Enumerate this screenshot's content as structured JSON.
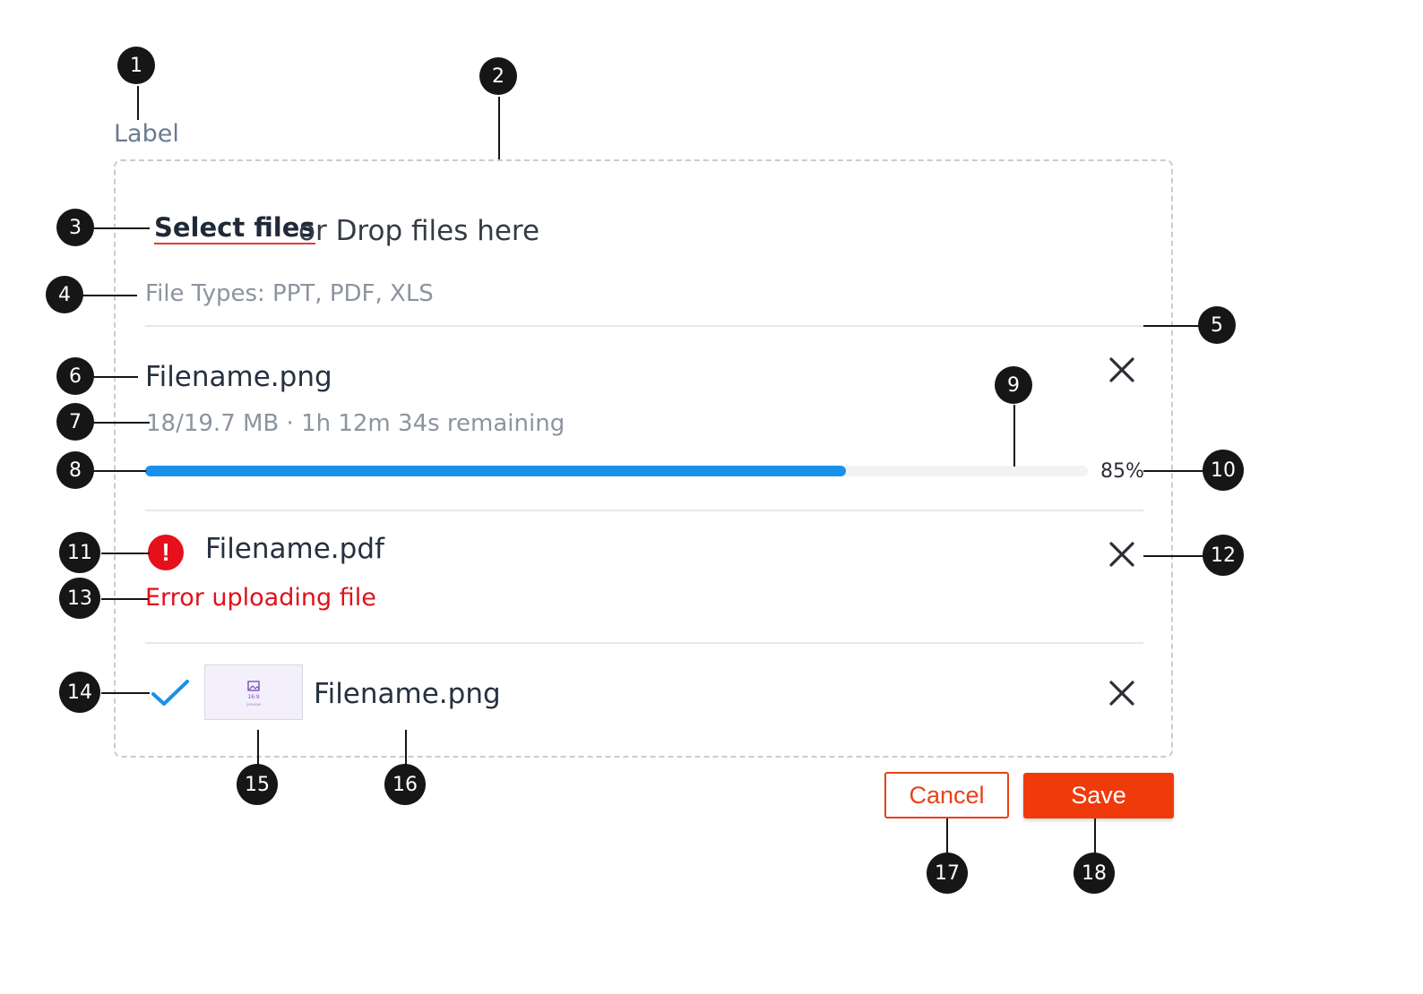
{
  "uploader": {
    "label": "Label",
    "select_files": "Select files",
    "drop_text": "or Drop files here",
    "file_types": "File Types: PPT, PDF, XLS"
  },
  "files": [
    {
      "name": "Filename.png",
      "status": "uploading",
      "meta": "18/19.7 MB · 1h 12m 34s remaining",
      "progress_percent": 85,
      "progress_label": "85%",
      "remove_icon": "close-icon"
    },
    {
      "name": "Filename.pdf",
      "status": "error",
      "status_icon": "error-icon",
      "status_icon_glyph": "!",
      "error_message": "Error uploading file",
      "remove_icon": "close-icon"
    },
    {
      "name": "Filename.png",
      "status": "complete",
      "status_icon": "check-icon",
      "thumbnail": {
        "line1": "16:9",
        "line2": "preview"
      },
      "remove_icon": "close-icon"
    }
  ],
  "actions": {
    "cancel": "Cancel",
    "save": "Save"
  },
  "callouts": [
    "1",
    "2",
    "3",
    "4",
    "5",
    "6",
    "7",
    "8",
    "9",
    "10",
    "11",
    "12",
    "13",
    "14",
    "15",
    "16",
    "17",
    "18"
  ],
  "colors": {
    "accent": "#f03a0c",
    "progress": "#1991eb",
    "error": "#e5101a",
    "success_check": "#1991eb",
    "callout": "#161616"
  }
}
